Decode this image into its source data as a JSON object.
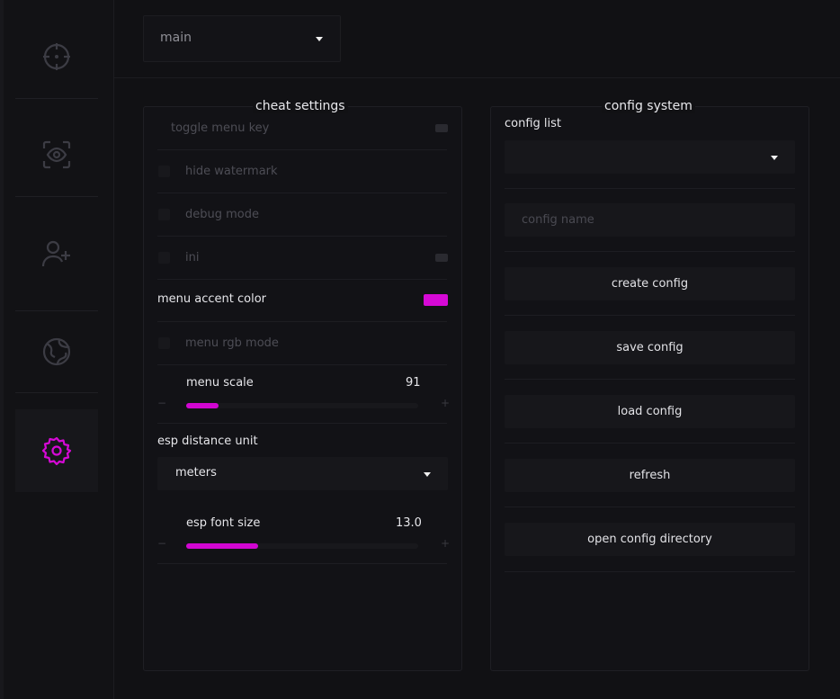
{
  "colors": {
    "accent": "#d609d6",
    "background": "#111114"
  },
  "sidebar": {
    "items": [
      {
        "icon": "crosshair-icon",
        "active": false
      },
      {
        "icon": "eye-scan-icon",
        "active": false
      },
      {
        "icon": "user-plus-icon",
        "active": false
      },
      {
        "icon": "globe-icon",
        "active": false
      },
      {
        "icon": "gear-icon",
        "active": true
      }
    ]
  },
  "top": {
    "dropdown_value": "main"
  },
  "cheat_settings": {
    "title": "cheat settings",
    "toggle_menu_key": "toggle menu key",
    "hide_watermark": "hide watermark",
    "debug_mode": "debug mode",
    "ini": "ini",
    "menu_accent_color": "menu accent color",
    "menu_rgb_mode": "menu rgb mode",
    "menu_scale": {
      "label": "menu scale",
      "value": "91",
      "fill": 0.14
    },
    "esp_distance_unit": {
      "label": "esp distance unit",
      "value": "meters"
    },
    "esp_font_size": {
      "label": "esp font size",
      "value": "13.0",
      "fill": 0.31
    },
    "minus": "−",
    "plus": "+"
  },
  "config_system": {
    "title": "config system",
    "config_list_label": "config list",
    "config_list_value": "",
    "config_name_placeholder": "config name",
    "buttons": {
      "create": "create config",
      "save": "save config",
      "load": "load config",
      "refresh": "refresh",
      "open_dir": "open config directory"
    }
  }
}
